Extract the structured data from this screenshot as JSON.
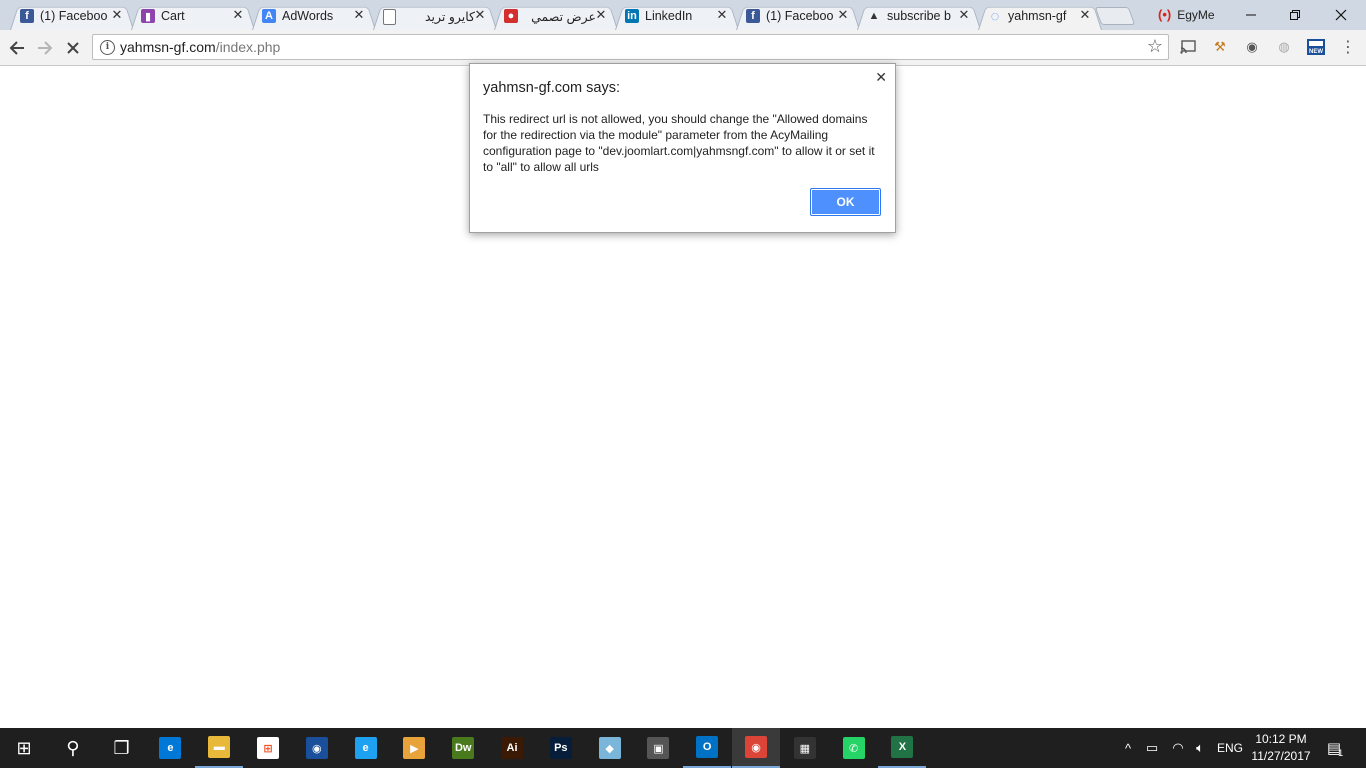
{
  "tabs": [
    {
      "title": "(1) Faceboo",
      "icon": "facebook-icon",
      "color": "#3b5998",
      "glyph": "f",
      "rtl": false
    },
    {
      "title": "Cart",
      "icon": "chart-bars-icon",
      "color": "#8e44ad",
      "glyph": "▮",
      "rtl": false
    },
    {
      "title": "AdWords",
      "icon": "adwords-icon",
      "color": "#4285f4",
      "glyph": "A",
      "rtl": false
    },
    {
      "title": "كايرو تريد",
      "icon": "document-icon",
      "color": "#ffffff",
      "glyph": "",
      "rtl": true
    },
    {
      "title": "عرض تصمي",
      "icon": "red-circle-icon",
      "color": "#d32f2f",
      "glyph": "●",
      "rtl": true
    },
    {
      "title": "LinkedIn",
      "icon": "linkedin-icon",
      "color": "#0077b5",
      "glyph": "in",
      "rtl": false
    },
    {
      "title": "(1) Faceboo",
      "icon": "facebook-icon",
      "color": "#3b5998",
      "glyph": "f",
      "rtl": false
    },
    {
      "title": "subscribe b",
      "icon": "mountain-icon",
      "color": "#333333",
      "glyph": "▲",
      "rtl": false
    },
    {
      "title": "yahmsn-gf",
      "icon": "loading-spinner-icon",
      "color": "#4d90fe",
      "glyph": "◌",
      "rtl": false
    }
  ],
  "profile": {
    "name": "EgyMe"
  },
  "address": {
    "host": "yahmsn-gf.com",
    "path": "/index.php"
  },
  "dialog": {
    "title": "yahmsn-gf.com says:",
    "message": "This redirect url is not allowed, you should change the \"Allowed domains for the redirection via the module\" parameter from the AcyMailing configuration page to \"dev.joomlart.com|yahmsngf.com\" to allow it or set it to \"all\" to allow all urls",
    "ok_label": "OK"
  },
  "taskbar": {
    "language": "ENG",
    "time": "10:12 PM",
    "date": "11/27/2017",
    "notification_count": "1",
    "apps": [
      {
        "name": "start-icon",
        "glyph": "⊞",
        "color": "#1f1f1f",
        "open": false,
        "active": false
      },
      {
        "name": "search-icon",
        "glyph": "⚲",
        "color": "#1f1f1f",
        "open": false,
        "active": false
      },
      {
        "name": "task-view-icon",
        "glyph": "❐",
        "color": "#1f1f1f",
        "open": false,
        "active": false
      },
      {
        "name": "edge-icon",
        "glyph": "e",
        "color": "#0078d7",
        "open": false,
        "active": false
      },
      {
        "name": "file-explorer-icon",
        "glyph": "▬",
        "color": "#e8b83a",
        "open": true,
        "active": false
      },
      {
        "name": "store-icon",
        "glyph": "⊞",
        "color": "#ffffff",
        "open": false,
        "active": false
      },
      {
        "name": "media-player-icon",
        "glyph": "◉",
        "color": "#1a4f9c",
        "open": false,
        "active": false
      },
      {
        "name": "internet-explorer-icon",
        "glyph": "e",
        "color": "#1ea1f1",
        "open": false,
        "active": false
      },
      {
        "name": "video-player-icon",
        "glyph": "▶",
        "color": "#e8a33a",
        "open": false,
        "active": false
      },
      {
        "name": "dreamweaver-icon",
        "glyph": "Dw",
        "color": "#4a7a1e",
        "open": false,
        "active": false
      },
      {
        "name": "illustrator-icon",
        "glyph": "Ai",
        "color": "#3a1a04",
        "open": false,
        "active": false
      },
      {
        "name": "photoshop-icon",
        "glyph": "Ps",
        "color": "#061e3a",
        "open": false,
        "active": false
      },
      {
        "name": "notes-icon",
        "glyph": "◆",
        "color": "#7ab6d9",
        "open": false,
        "active": false
      },
      {
        "name": "network-icon",
        "glyph": "▣",
        "color": "#555555",
        "open": false,
        "active": false
      },
      {
        "name": "outlook-icon",
        "glyph": "O",
        "color": "#0072c6",
        "open": true,
        "active": false
      },
      {
        "name": "chrome-icon",
        "glyph": "◉",
        "color": "#db4437",
        "open": true,
        "active": true
      },
      {
        "name": "calculator-icon",
        "glyph": "▦",
        "color": "#333333",
        "open": false,
        "active": false
      },
      {
        "name": "whatsapp-icon",
        "glyph": "✆",
        "color": "#25d366",
        "open": false,
        "active": false
      },
      {
        "name": "excel-icon",
        "glyph": "X",
        "color": "#217346",
        "open": true,
        "active": false
      }
    ]
  }
}
